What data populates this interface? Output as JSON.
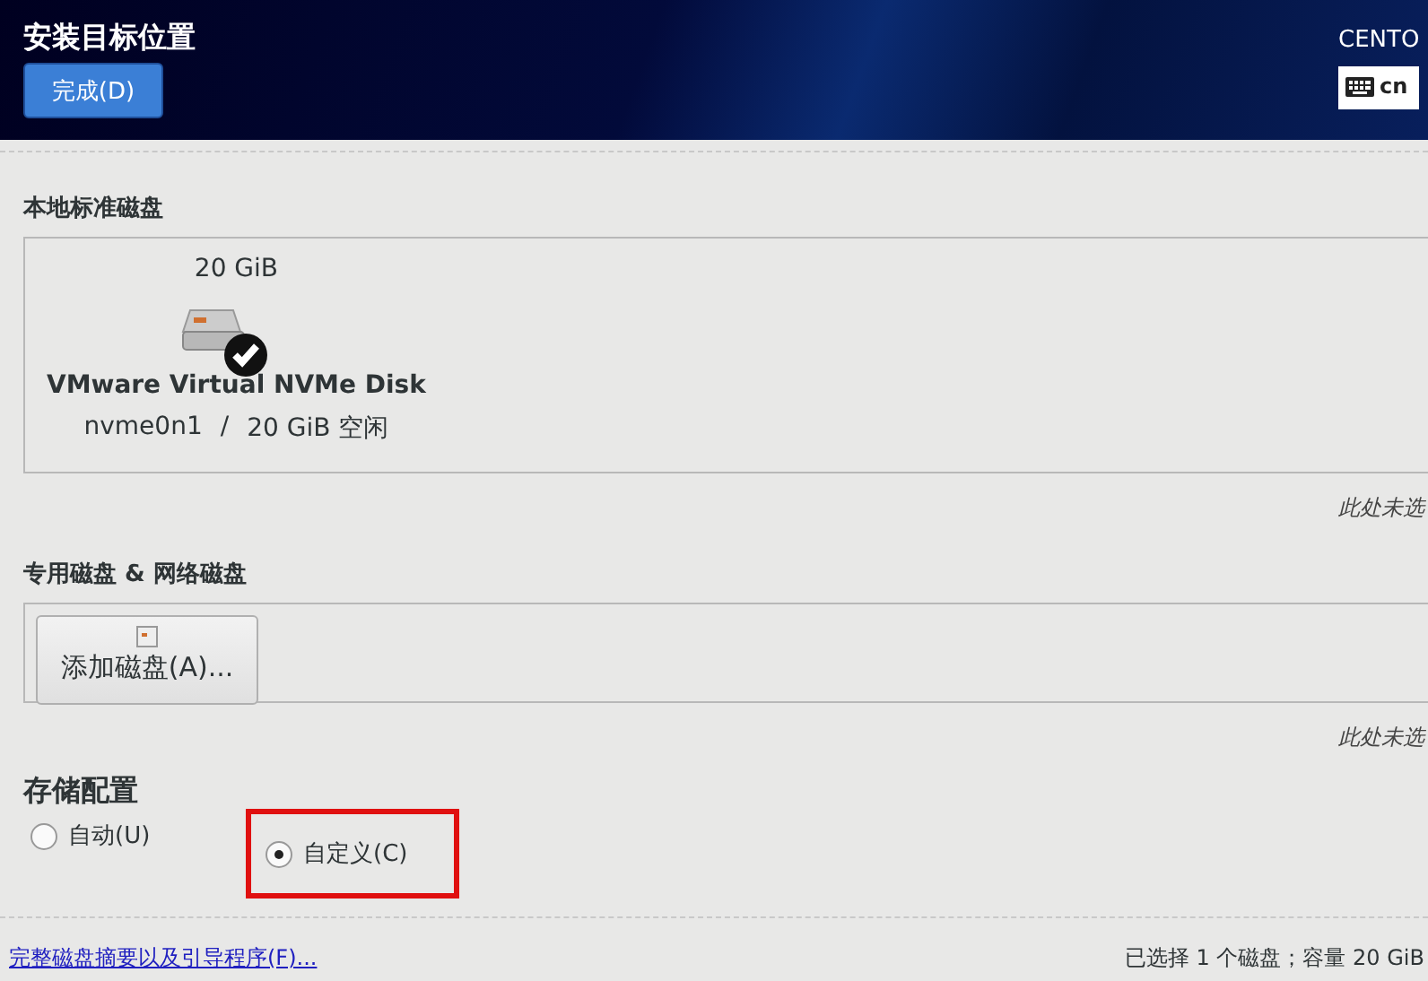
{
  "header": {
    "title": "安装目标位置",
    "done_button": "完成(D)",
    "product": "CENTO",
    "keyboard_layout": "cn"
  },
  "local_disks": {
    "heading": "本地标准磁盘",
    "disks": [
      {
        "size": "20 GiB",
        "name": "VMware Virtual NVMe Disk",
        "device": "nvme0n1",
        "separator": "/",
        "free": "20 GiB 空闲",
        "selected": true
      }
    ],
    "note": "此处未选"
  },
  "special_disks": {
    "heading": "专用磁盘 & 网络磁盘",
    "add_button": "添加磁盘(A)...",
    "note": "此处未选"
  },
  "storage_config": {
    "heading": "存储配置",
    "options": [
      {
        "label": "自动(U)",
        "selected": false,
        "highlighted": false
      },
      {
        "label": "自定义(C)",
        "selected": true,
        "highlighted": true
      }
    ]
  },
  "footer": {
    "link": "完整磁盘摘要以及引导程序(F)...",
    "summary": "已选择 1 个磁盘；容量 20 GiB"
  }
}
